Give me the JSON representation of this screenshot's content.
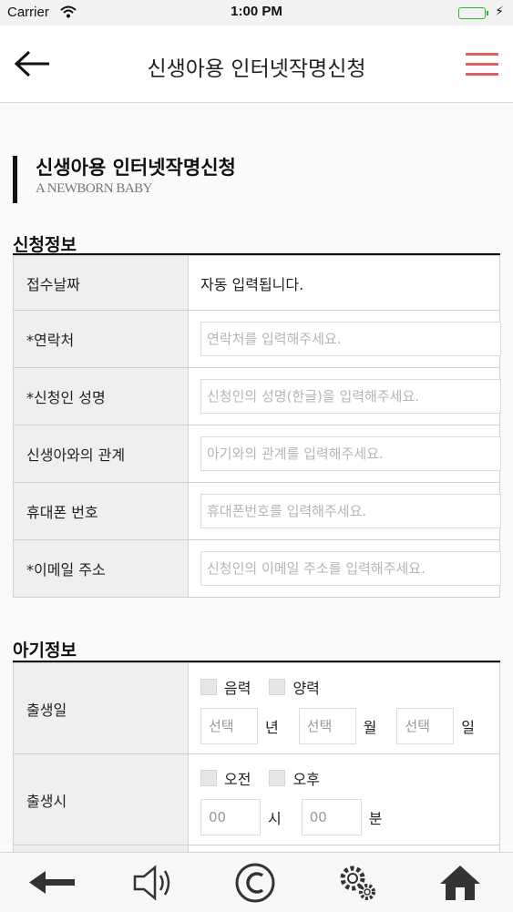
{
  "status_bar": {
    "carrier": "Carrier",
    "time": "1:00 PM"
  },
  "header": {
    "title": "신생아용 인터넷작명신청"
  },
  "section": {
    "title": "신생아용 인터넷작명신청",
    "subtitle": "A NEWBORN BABY"
  },
  "applicant": {
    "title": "신청정보",
    "rows": [
      {
        "label": "접수날짜",
        "value": "자동 입력됩니다."
      },
      {
        "label": "*연락처",
        "placeholder": "연락처를 입력해주세요."
      },
      {
        "label": "*신청인 성명",
        "placeholder": "신청인의 성명(한글)을 입력해주세요."
      },
      {
        "label": "신생아와의 관계",
        "placeholder": "아기와의 관계를 입력해주세요."
      },
      {
        "label": "휴대폰 번호",
        "placeholder": "휴대폰번호를 입력해주세요."
      },
      {
        "label": "*이메일 주소",
        "placeholder": "신청인의 이메일 주소를 입력해주세요."
      }
    ]
  },
  "baby": {
    "title": "아기정보",
    "birth_date": {
      "label": "출생일",
      "option_lunar": "음력",
      "option_solar": "양력",
      "select_year": "선택",
      "unit_year": "년",
      "select_month": "선택",
      "unit_month": "월",
      "select_day": "선택",
      "unit_day": "일"
    },
    "birth_time": {
      "label": "출생시",
      "option_am": "오전",
      "option_pm": "오후",
      "hour": "00",
      "unit_hour": "시",
      "minute": "00",
      "unit_minute": "분"
    }
  },
  "bottom_bar": {
    "items": [
      "back-icon",
      "speaker-icon",
      "copyright-icon",
      "settings-icon",
      "home-icon"
    ]
  },
  "colors": {
    "menu_accent": "#e06060",
    "battery": "#2ecc40"
  }
}
